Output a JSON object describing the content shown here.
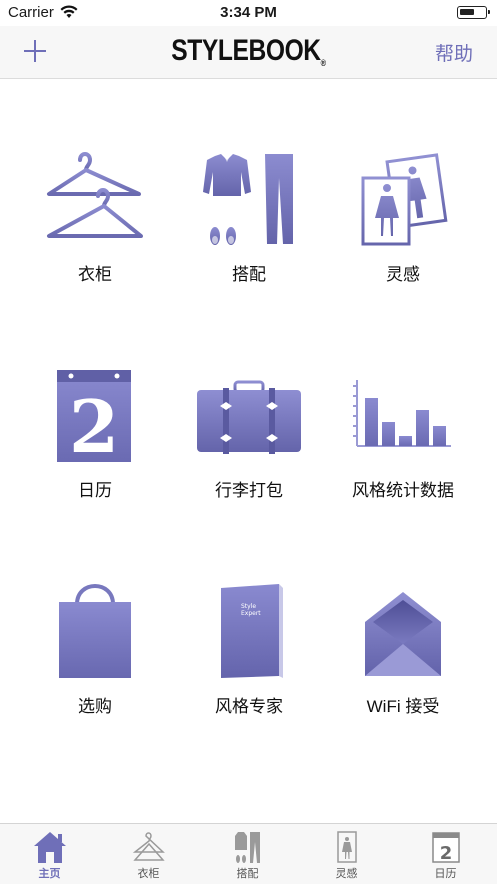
{
  "status_bar": {
    "carrier": "Carrier",
    "time": "3:34 PM"
  },
  "nav": {
    "title": "STYLEBOOK",
    "registered": "®",
    "help_label": "帮助"
  },
  "grid": [
    {
      "label": "衣柜",
      "icon": "hanger-icon"
    },
    {
      "label": "搭配",
      "icon": "outfit-icon"
    },
    {
      "label": "灵感",
      "icon": "inspiration-photos-icon"
    },
    {
      "label": "日历",
      "icon": "calendar-icon",
      "calendar_day": "2"
    },
    {
      "label": "行李打包",
      "icon": "suitcase-icon"
    },
    {
      "label": "风格统计数据",
      "icon": "bar-chart-icon"
    },
    {
      "label": "选购",
      "icon": "shopping-bag-icon"
    },
    {
      "label": "风格专家",
      "icon": "book-icon",
      "book_text_1": "Style",
      "book_text_2": "Expert"
    },
    {
      "label": "WiFi 接受",
      "icon": "envelope-icon"
    }
  ],
  "tabs": [
    {
      "label": "主页",
      "icon": "home-icon",
      "active": true
    },
    {
      "label": "衣柜",
      "icon": "hanger-icon",
      "active": false
    },
    {
      "label": "搭配",
      "icon": "outfit-icon",
      "active": false
    },
    {
      "label": "灵感",
      "icon": "inspiration-icon",
      "active": false
    },
    {
      "label": "日历",
      "icon": "calendar-icon",
      "active": false,
      "calendar_day": "2"
    }
  ],
  "colors": {
    "accent": "#6f6fb8",
    "icon_fill": "#8282c8",
    "icon_dark": "#5f5fa6",
    "inactive": "#9a9a9a"
  }
}
